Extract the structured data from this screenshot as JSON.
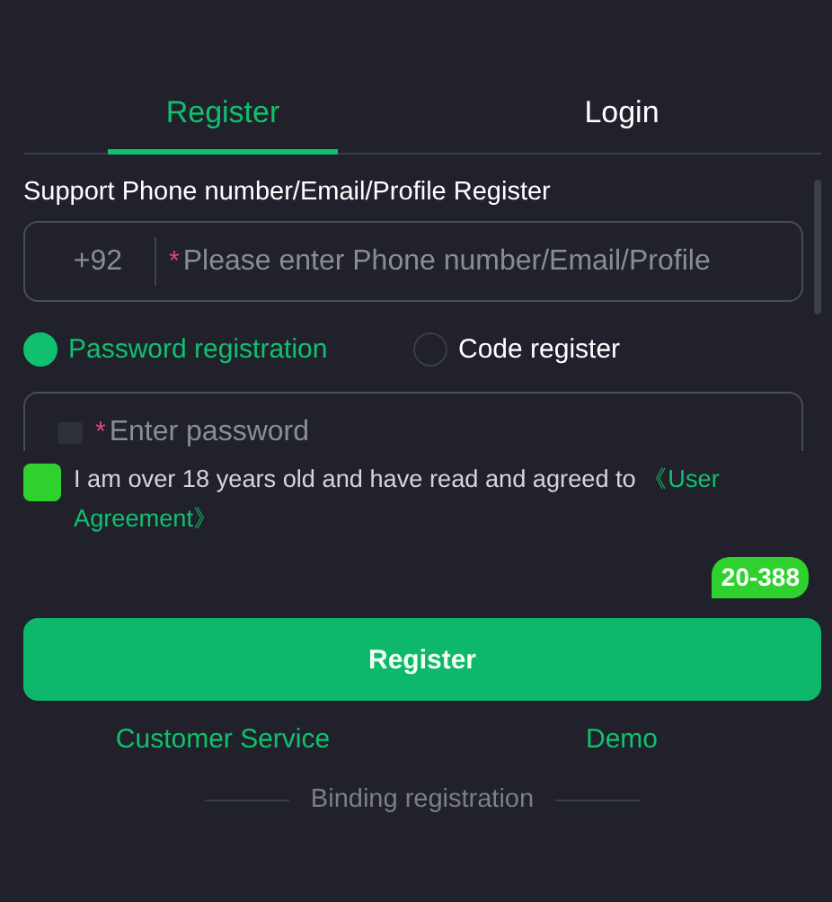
{
  "tabs": [
    {
      "label": "Register",
      "selected": true
    },
    {
      "label": "Login",
      "selected": false
    }
  ],
  "form": {
    "label": "Support Phone number/Email/Profile Register",
    "country_code": "+92",
    "account_placeholder": "Please enter Phone number/Email/Profile",
    "required_mark": "*",
    "methods": [
      {
        "label": "Password registration",
        "selected": true
      },
      {
        "label": "Code register",
        "selected": false
      }
    ],
    "password_placeholder": "Enter password"
  },
  "agreement": {
    "checked": true,
    "text": "I am over 18 years old and have read and agreed to",
    "link_parts": [
      "《User",
      "Agreement》"
    ]
  },
  "badge": "20-388",
  "register_button": "Register",
  "links": [
    "Customer Service",
    "Demo"
  ],
  "divider_text": "Binding registration"
}
